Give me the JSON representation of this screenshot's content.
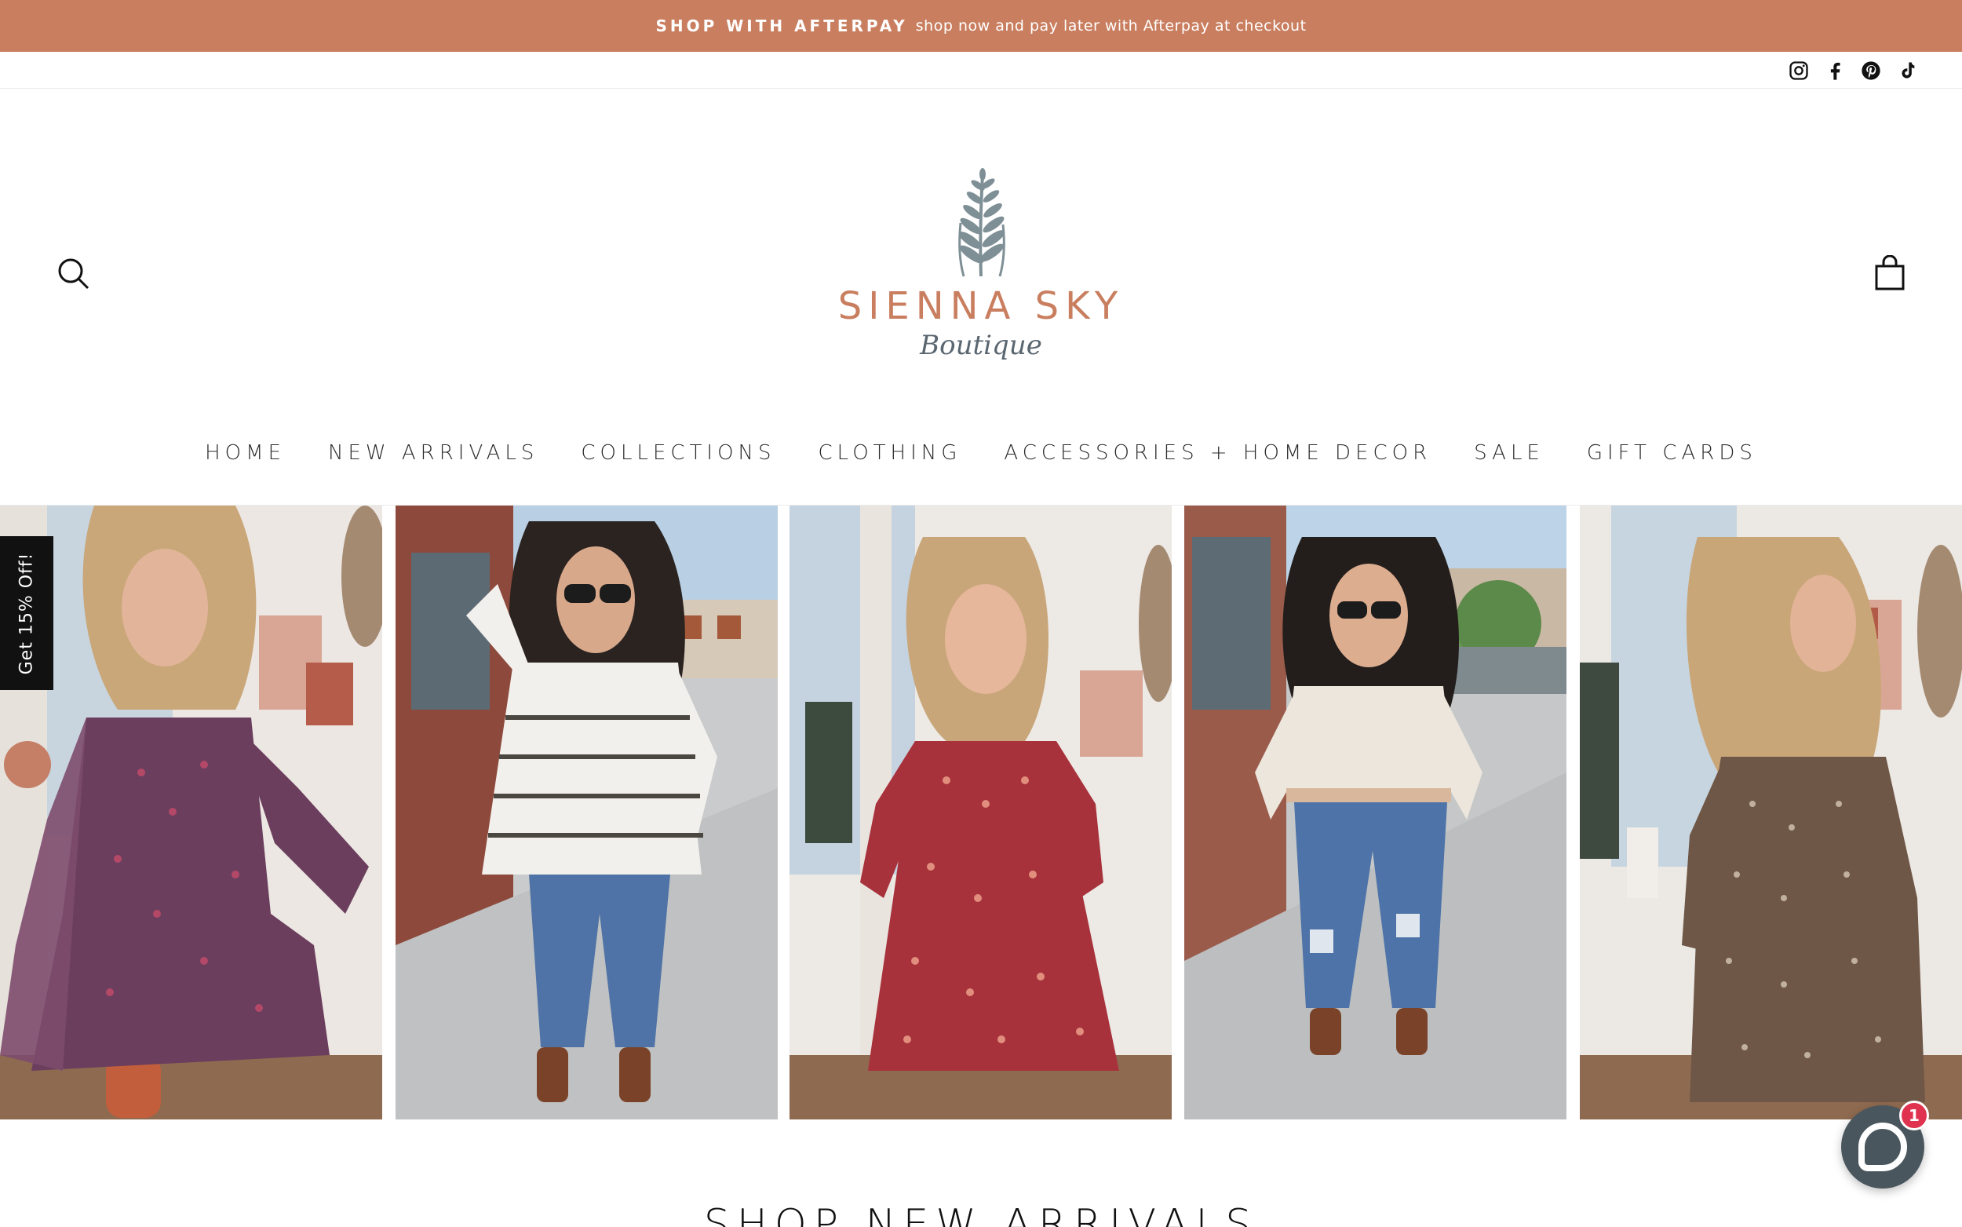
{
  "announcement": {
    "strong": "SHOP WITH AFTERPAY",
    "text": "shop now and pay later with Afterpay at checkout"
  },
  "social": [
    "instagram-icon",
    "facebook-icon",
    "pinterest-icon",
    "tiktok-icon"
  ],
  "header": {
    "search_icon": "search-icon",
    "cart_icon": "cart-icon",
    "logo_name": "SIENNA SKY",
    "logo_script": "Boutique"
  },
  "nav": {
    "items": [
      {
        "label": "HOME"
      },
      {
        "label": "NEW ARRIVALS"
      },
      {
        "label": "COLLECTIONS"
      },
      {
        "label": "CLOTHING"
      },
      {
        "label": "ACCESSORIES + HOME DECOR"
      },
      {
        "label": "SALE"
      },
      {
        "label": "GIFT CARDS"
      }
    ]
  },
  "side_tab": "Get 15% Off!",
  "section_title": "SHOP NEW ARRIVALS",
  "chat": {
    "badge": "1"
  },
  "colors": {
    "brand": "#c97e5f",
    "sprig": "#7f8f96",
    "chat": "#4a565e",
    "badge": "#e0334f"
  }
}
